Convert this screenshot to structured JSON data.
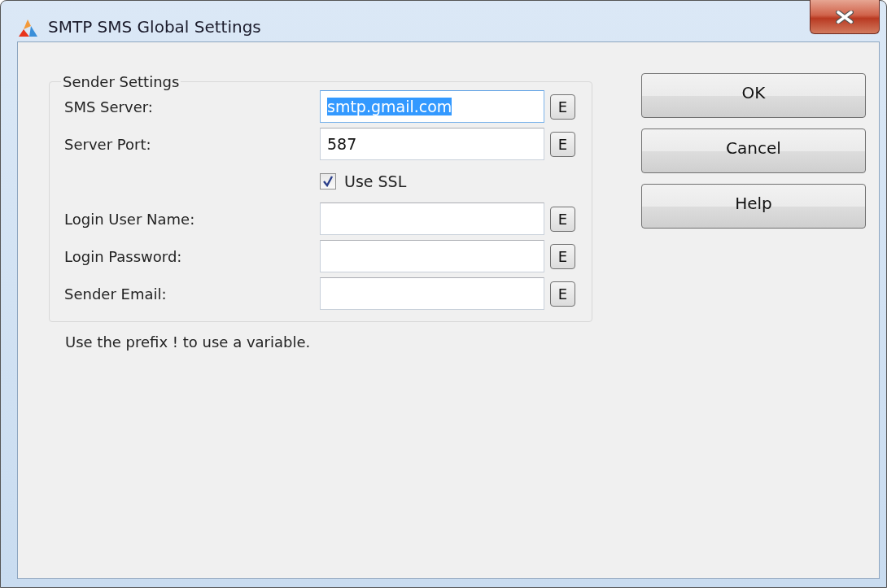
{
  "window": {
    "title": "SMTP SMS Global Settings"
  },
  "group": {
    "title": "Sender Settings",
    "rows": [
      {
        "kind": "field",
        "label": "SMS Server:",
        "value": "smtp.gmail.com",
        "selected": true,
        "edit": "E"
      },
      {
        "kind": "field",
        "label": "Server Port:",
        "value": "587",
        "selected": false,
        "edit": "E"
      },
      {
        "kind": "checkbox",
        "label": "Use SSL",
        "checked": true
      },
      {
        "kind": "field",
        "label": "Login User Name:",
        "selected": false,
        "edit": "E"
      },
      {
        "kind": "field",
        "label": "Login Password:",
        "selected": false,
        "edit": "E"
      },
      {
        "kind": "field",
        "label": "Sender Email:",
        "selected": false,
        "edit": "E"
      }
    ]
  },
  "hint": "Use the prefix ! to use a variable.",
  "buttons": [
    "OK",
    "Cancel",
    "Help"
  ]
}
